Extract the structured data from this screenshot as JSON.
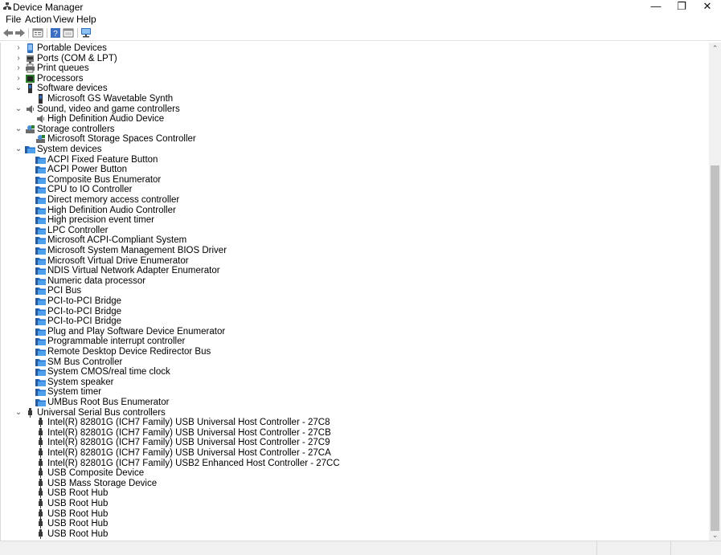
{
  "window": {
    "title": "Device Manager",
    "minimize": "—",
    "restore": "❐",
    "close": "✕"
  },
  "menu": [
    "File",
    "Action",
    "View",
    "Help"
  ],
  "toolbar": [
    "back-icon",
    "forward-icon",
    "properties-icon",
    "help-icon",
    "details-icon",
    "computer-monitor-icon"
  ],
  "tree": [
    {
      "label": "Portable Devices",
      "level": 0,
      "expander": "›",
      "icon": "portable-device-icon"
    },
    {
      "label": "Ports (COM & LPT)",
      "level": 0,
      "expander": "›",
      "icon": "port-icon"
    },
    {
      "label": "Print queues",
      "level": 0,
      "expander": "›",
      "icon": "printer-icon"
    },
    {
      "label": "Processors",
      "level": 0,
      "expander": "›",
      "icon": "processor-icon"
    },
    {
      "label": "Software devices",
      "level": 0,
      "expander": "⌄",
      "icon": "software-device-icon"
    },
    {
      "label": "Microsoft GS Wavetable Synth",
      "level": 1,
      "icon": "software-device-icon"
    },
    {
      "label": "Sound, video and game controllers",
      "level": 0,
      "expander": "⌄",
      "icon": "speaker-icon"
    },
    {
      "label": "High Definition Audio Device",
      "level": 1,
      "icon": "speaker-icon"
    },
    {
      "label": "Storage controllers",
      "level": 0,
      "expander": "⌄",
      "icon": "storage-controller-icon"
    },
    {
      "label": "Microsoft Storage Spaces Controller",
      "level": 1,
      "icon": "storage-controller-icon"
    },
    {
      "label": "System devices",
      "level": 0,
      "expander": "⌄",
      "icon": "system-folder-icon"
    },
    {
      "label": "ACPI Fixed Feature Button",
      "level": 1,
      "icon": "system-folder-icon"
    },
    {
      "label": "ACPI Power Button",
      "level": 1,
      "icon": "system-folder-icon"
    },
    {
      "label": "Composite Bus Enumerator",
      "level": 1,
      "icon": "system-folder-icon"
    },
    {
      "label": "CPU to IO Controller",
      "level": 1,
      "icon": "system-folder-icon"
    },
    {
      "label": "Direct memory access controller",
      "level": 1,
      "icon": "system-folder-icon"
    },
    {
      "label": "High Definition Audio Controller",
      "level": 1,
      "icon": "system-folder-icon"
    },
    {
      "label": "High precision event timer",
      "level": 1,
      "icon": "system-folder-icon"
    },
    {
      "label": "LPC Controller",
      "level": 1,
      "icon": "system-folder-icon"
    },
    {
      "label": "Microsoft ACPI-Compliant System",
      "level": 1,
      "icon": "system-folder-icon"
    },
    {
      "label": "Microsoft System Management BIOS Driver",
      "level": 1,
      "icon": "system-folder-icon"
    },
    {
      "label": "Microsoft Virtual Drive Enumerator",
      "level": 1,
      "icon": "system-folder-icon"
    },
    {
      "label": "NDIS Virtual Network Adapter Enumerator",
      "level": 1,
      "icon": "system-folder-icon"
    },
    {
      "label": "Numeric data processor",
      "level": 1,
      "icon": "system-folder-icon"
    },
    {
      "label": "PCI Bus",
      "level": 1,
      "icon": "system-folder-icon"
    },
    {
      "label": "PCI-to-PCI Bridge",
      "level": 1,
      "icon": "system-folder-icon"
    },
    {
      "label": "PCI-to-PCI Bridge",
      "level": 1,
      "icon": "system-folder-icon"
    },
    {
      "label": "PCI-to-PCI Bridge",
      "level": 1,
      "icon": "system-folder-icon"
    },
    {
      "label": "Plug and Play Software Device Enumerator",
      "level": 1,
      "icon": "system-folder-icon"
    },
    {
      "label": "Programmable interrupt controller",
      "level": 1,
      "icon": "system-folder-icon"
    },
    {
      "label": "Remote Desktop Device Redirector Bus",
      "level": 1,
      "icon": "system-folder-icon"
    },
    {
      "label": "SM Bus Controller",
      "level": 1,
      "icon": "system-folder-icon"
    },
    {
      "label": "System CMOS/real time clock",
      "level": 1,
      "icon": "system-folder-icon"
    },
    {
      "label": "System speaker",
      "level": 1,
      "icon": "system-folder-icon"
    },
    {
      "label": "System timer",
      "level": 1,
      "icon": "system-folder-icon"
    },
    {
      "label": "UMBus Root Bus Enumerator",
      "level": 1,
      "icon": "system-folder-icon"
    },
    {
      "label": "Universal Serial Bus controllers",
      "level": 0,
      "expander": "⌄",
      "icon": "usb-icon"
    },
    {
      "label": "Intel(R) 82801G (ICH7 Family) USB Universal Host Controller - 27C8",
      "level": 1,
      "icon": "usb-icon"
    },
    {
      "label": "Intel(R) 82801G (ICH7 Family) USB Universal Host Controller - 27CB",
      "level": 1,
      "icon": "usb-icon"
    },
    {
      "label": "Intel(R) 82801G (ICH7 Family) USB Universal Host Controller - 27C9",
      "level": 1,
      "icon": "usb-icon"
    },
    {
      "label": "Intel(R) 82801G (ICH7 Family) USB Universal Host Controller - 27CA",
      "level": 1,
      "icon": "usb-icon"
    },
    {
      "label": "Intel(R) 82801G (ICH7 Family) USB2 Enhanced Host Controller - 27CC",
      "level": 1,
      "icon": "usb-icon"
    },
    {
      "label": "USB Composite Device",
      "level": 1,
      "icon": "usb-icon"
    },
    {
      "label": "USB Mass Storage Device",
      "level": 1,
      "icon": "usb-icon"
    },
    {
      "label": "USB Root Hub",
      "level": 1,
      "icon": "usb-icon"
    },
    {
      "label": "USB Root Hub",
      "level": 1,
      "icon": "usb-icon"
    },
    {
      "label": "USB Root Hub",
      "level": 1,
      "icon": "usb-icon"
    },
    {
      "label": "USB Root Hub",
      "level": 1,
      "icon": "usb-icon"
    },
    {
      "label": "USB Root Hub",
      "level": 1,
      "icon": "usb-icon"
    }
  ],
  "scrollbar": {
    "up": "⌃",
    "down": "⌄"
  },
  "colors": {
    "system_blue": "#1f6fd0",
    "folder_dark": "#2a5a9a",
    "usb_gray": "#3a3a3a"
  }
}
